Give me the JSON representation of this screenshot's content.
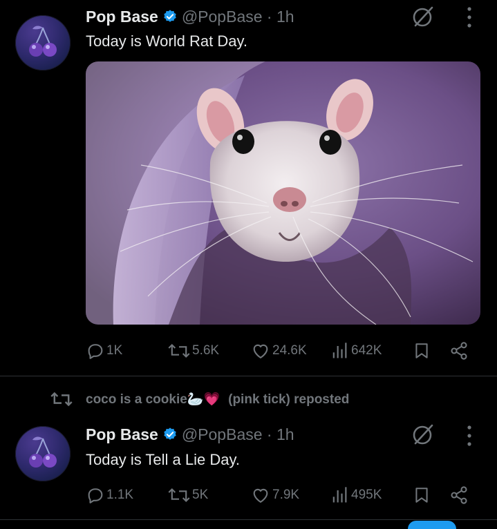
{
  "tweets": [
    {
      "author": "Pop Base",
      "handle": "@PopBase · 1h",
      "text": "Today is World Rat Day.",
      "replies": "1K",
      "reposts": "5.6K",
      "likes": "24.6K",
      "views": "642K"
    },
    {
      "author": "Pop Base",
      "handle": "@PopBase · 1h",
      "text": "Today is Tell a Lie Day.",
      "replies": "1.1K",
      "reposts": "5K",
      "likes": "7.9K",
      "views": "495K"
    }
  ],
  "repost_banner": {
    "user": "coco is a cookie",
    "emoji": "🦢💗",
    "suffix": "(pink tick) reposted"
  },
  "icons": {
    "avatar": "cherries-logo",
    "verified": "verified-badge-icon",
    "grok": "grok-icon",
    "more": "more-dots-icon",
    "reply": "reply-icon",
    "repost": "repost-icon",
    "like": "heart-icon",
    "views": "views-icon",
    "bookmark": "bookmark-icon",
    "share": "share-icon"
  },
  "colors": {
    "background": "#000000",
    "text": "#e7e9ea",
    "muted": "#71767b",
    "verified": "#1d9bf0"
  }
}
